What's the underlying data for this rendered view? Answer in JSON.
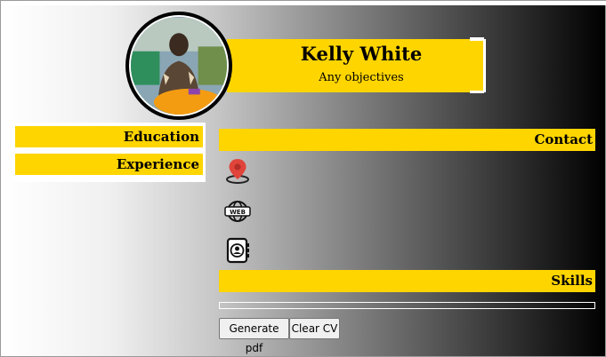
{
  "profile": {
    "name": "Kelly White",
    "objective": "Any objectives",
    "avatar_icon": "profile-photo"
  },
  "left_nav": {
    "items": [
      {
        "label": "Education"
      },
      {
        "label": "Experience"
      }
    ]
  },
  "sections": {
    "contact_title": "Contact",
    "skills_title": "Skills"
  },
  "contact_icons": [
    "location-pin-icon",
    "web-icon",
    "address-book-icon"
  ],
  "buttons": {
    "generate_pdf": "Generate pdf",
    "clear_cv": "Clear CV"
  },
  "colors": {
    "accent": "#ffd500",
    "text": "#000000",
    "pin": "#e0443a"
  }
}
